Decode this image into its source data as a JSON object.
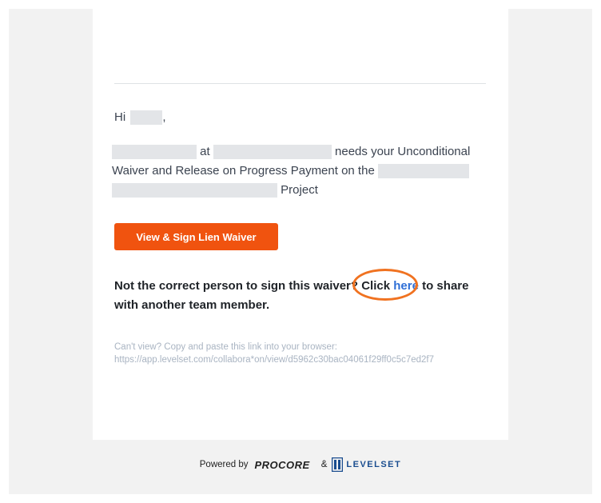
{
  "email": {
    "greeting": "Hi",
    "greeting_punct": ",",
    "body_at": "at",
    "body_text": "needs your Unconditional Waiver and Release on Progress Payment on the",
    "body_project": "Project",
    "cta_button": "View & Sign Lien Waiver",
    "wrong_person_prefix": "Not the correct person to sign this waiver? Click",
    "wrong_person_link": "here",
    "wrong_person_suffix": "to share with another team member.",
    "cant_view": "Can't view? Copy and paste this link into your browser:",
    "fallback_url": "https://app.levelset.com/collabora*on/view/d5962c30bac04061f29ff0c5c7ed2f7"
  },
  "footer": {
    "powered_by": "Powered by",
    "procore": "PROCORE",
    "ampersand": "&",
    "levelset": "LEVELSET"
  },
  "colors": {
    "cta": "#f0530f",
    "link": "#2f6fd6",
    "annotation_ring": "#f07220"
  }
}
